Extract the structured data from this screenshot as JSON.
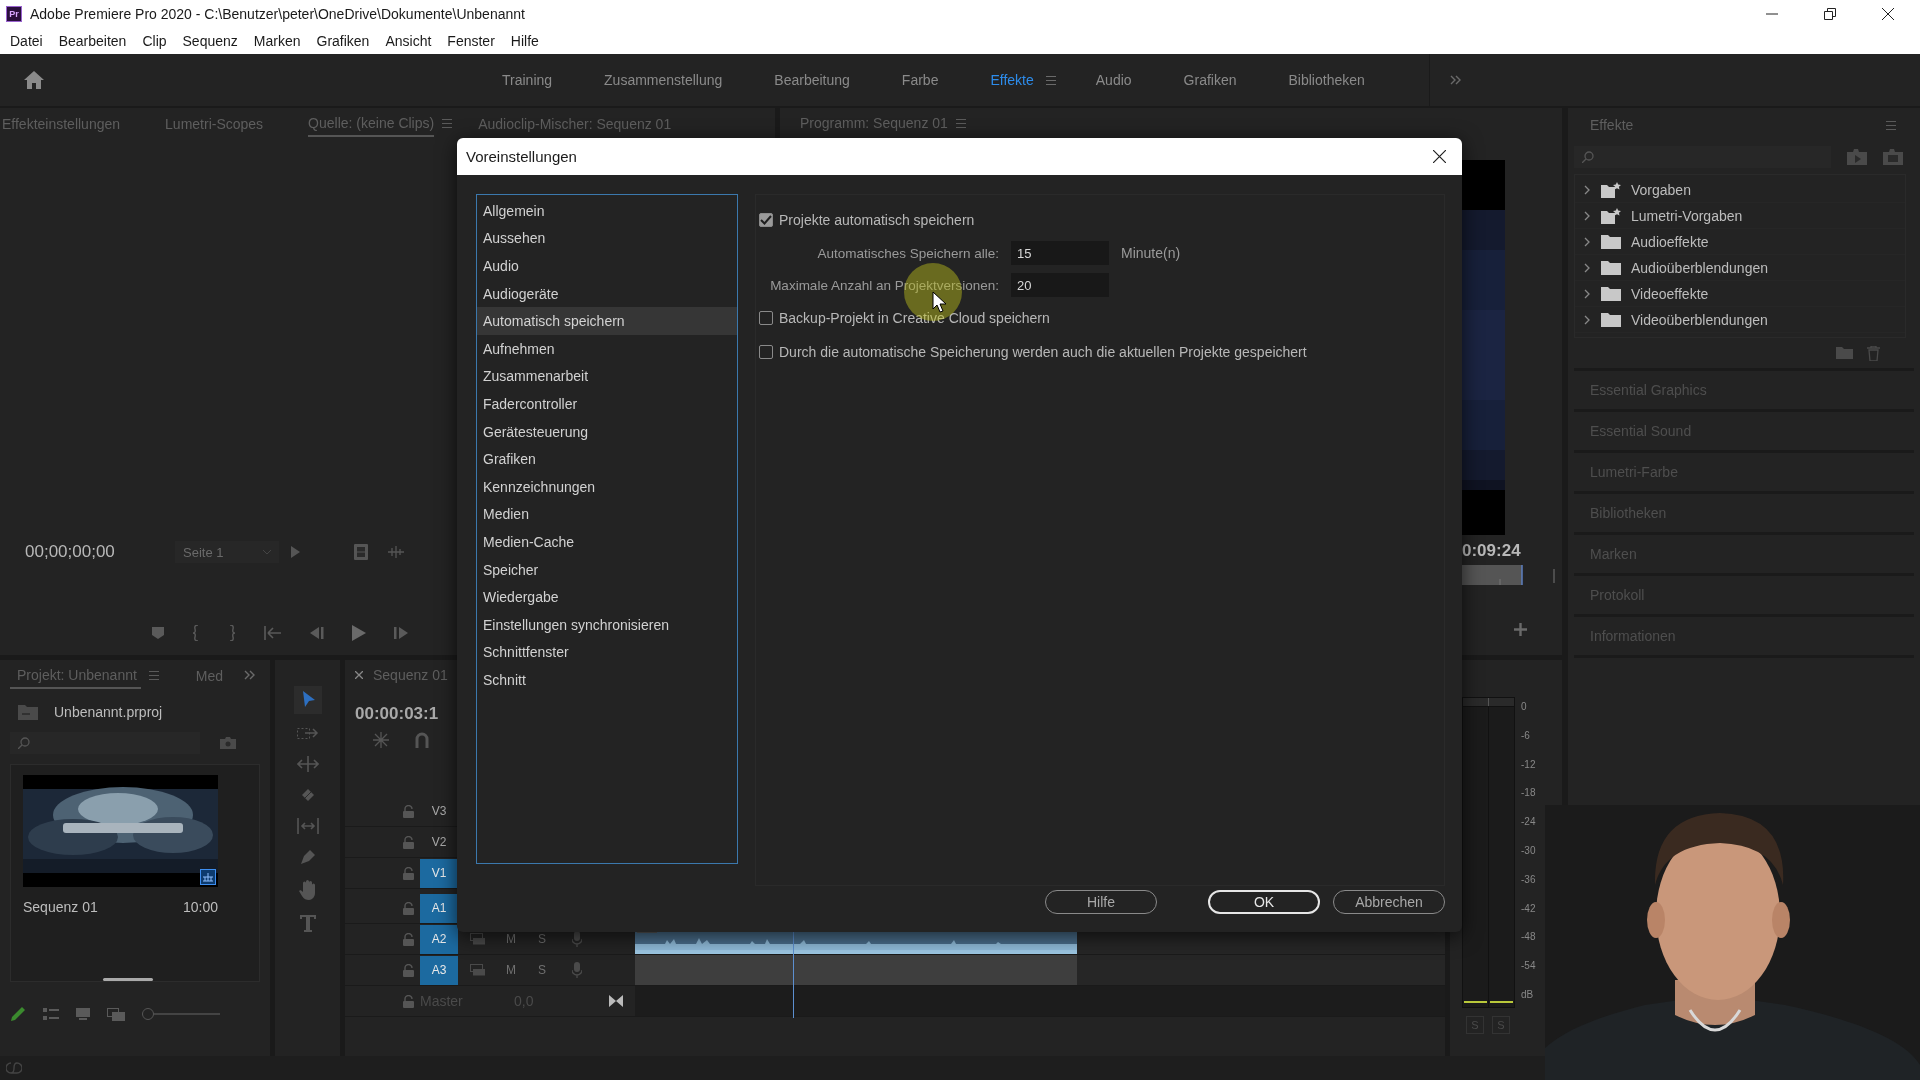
{
  "window": {
    "logo": "Pr",
    "title": "Adobe Premiere Pro 2020 - C:\\Benutzer\\peter\\OneDrive\\Dokumente\\Unbenannt"
  },
  "menu": [
    "Datei",
    "Bearbeiten",
    "Clip",
    "Sequenz",
    "Marken",
    "Grafiken",
    "Ansicht",
    "Fenster",
    "Hilfe"
  ],
  "workspaces": [
    {
      "label": "Training",
      "selected": false
    },
    {
      "label": "Zusammenstellung",
      "selected": false
    },
    {
      "label": "Bearbeitung",
      "selected": false
    },
    {
      "label": "Farbe",
      "selected": false
    },
    {
      "label": "Effekte",
      "selected": true
    },
    {
      "label": "Audio",
      "selected": false
    },
    {
      "label": "Grafiken",
      "selected": false
    },
    {
      "label": "Bibliotheken",
      "selected": false
    }
  ],
  "source_panel": {
    "tabs": [
      {
        "label": "Effekteinstellungen",
        "selected": false
      },
      {
        "label": "Lumetri-Scopes",
        "selected": false
      },
      {
        "label": "Quelle: (keine Clips)",
        "selected": true
      },
      {
        "label": "Audioclip-Mischer: Sequenz 01",
        "selected": false
      }
    ],
    "timecode": "00;00;00;00",
    "page_select": "Seite 1"
  },
  "program_panel": {
    "tab": "Programm: Sequenz 01",
    "timecode": "0:09:24"
  },
  "effects_panel": {
    "title": "Effekte",
    "tree": [
      {
        "label": "Vorgaben",
        "kind": "preset",
        "expanded": false
      },
      {
        "label": "Lumetri-Vorgaben",
        "kind": "preset",
        "expanded": false
      },
      {
        "label": "Audioeffekte",
        "kind": "folder",
        "expanded": false
      },
      {
        "label": "Audioüberblendungen",
        "kind": "folder",
        "expanded": false
      },
      {
        "label": "Videoeffekte",
        "kind": "folder",
        "expanded": false
      },
      {
        "label": "Videoüberblendungen",
        "kind": "folder",
        "expanded": false
      }
    ],
    "sections": [
      "Essential Graphics",
      "Essential Sound",
      "Lumetri-Farbe",
      "Bibliotheken",
      "Marken",
      "Protokoll",
      "Informationen"
    ]
  },
  "project_panel": {
    "tabs": [
      {
        "label": "Projekt: Unbenannt",
        "selected": true
      },
      {
        "label": "Med",
        "selected": false
      }
    ],
    "file": "Unbenannt.prproj",
    "item": {
      "name": "Sequenz 01",
      "duration": "10:00"
    },
    "zoom_slider": {
      "level": 0
    }
  },
  "timeline": {
    "tab": "Sequenz 01",
    "timecode": "00:00:03:1",
    "tracks": [
      {
        "label": "V3",
        "targeted": false
      },
      {
        "label": "V2",
        "targeted": false
      },
      {
        "label": "V1",
        "targeted": true
      },
      {
        "label": "A1",
        "targeted": true
      },
      {
        "label": "A2",
        "targeted": true,
        "mute": "M",
        "solo": "S",
        "clip": {
          "kind": "waveform"
        }
      },
      {
        "label": "A3",
        "targeted": true,
        "mute": "M",
        "solo": "S",
        "clip": {
          "kind": "plain"
        }
      }
    ],
    "master": {
      "label": "Master",
      "value": "0,0"
    }
  },
  "audio_meter": {
    "ticks": [
      "0",
      "-6",
      "-12",
      "-18",
      "-24",
      "-30",
      "-36",
      "-42",
      "-48",
      "-54",
      "dB"
    ],
    "solo": [
      "S",
      "S"
    ]
  },
  "dialog": {
    "title": "Voreinstellungen",
    "categories": [
      {
        "label": "Allgemein",
        "selected": false
      },
      {
        "label": "Aussehen",
        "selected": false
      },
      {
        "label": "Audio",
        "selected": false
      },
      {
        "label": "Audiogeräte",
        "selected": false
      },
      {
        "label": "Automatisch speichern",
        "selected": true
      },
      {
        "label": "Aufnehmen",
        "selected": false
      },
      {
        "label": "Zusammenarbeit",
        "selected": false
      },
      {
        "label": "Fadercontroller",
        "selected": false
      },
      {
        "label": "Gerätesteuerung",
        "selected": false
      },
      {
        "label": "Grafiken",
        "selected": false
      },
      {
        "label": "Kennzeichnungen",
        "selected": false
      },
      {
        "label": "Medien",
        "selected": false
      },
      {
        "label": "Medien-Cache",
        "selected": false
      },
      {
        "label": "Speicher",
        "selected": false
      },
      {
        "label": "Wiedergabe",
        "selected": false
      },
      {
        "label": "Einstellungen synchronisieren",
        "selected": false
      },
      {
        "label": "Schnittfenster",
        "selected": false
      },
      {
        "label": "Schnitt",
        "selected": false
      }
    ],
    "settings": [
      {
        "kind": "checkbox",
        "label": "Projekte automatisch speichern",
        "checked": true
      },
      {
        "kind": "number",
        "label": "Automatisches Speichern alle:",
        "value": "15",
        "unit": "Minute(n)"
      },
      {
        "kind": "number",
        "label": "Maximale Anzahl an Projektversionen:",
        "value": "20"
      },
      {
        "kind": "checkbox",
        "label": "Backup-Projekt in Creative Cloud speichern",
        "checked": false
      },
      {
        "kind": "checkbox",
        "label": "Durch die automatische Speicherung werden auch die aktuellen Projekte gespeichert",
        "checked": false
      }
    ],
    "buttons": [
      {
        "label": "Hilfe",
        "default": false
      },
      {
        "label": "OK",
        "default": true
      },
      {
        "label": "Abbrechen",
        "default": false
      }
    ]
  }
}
